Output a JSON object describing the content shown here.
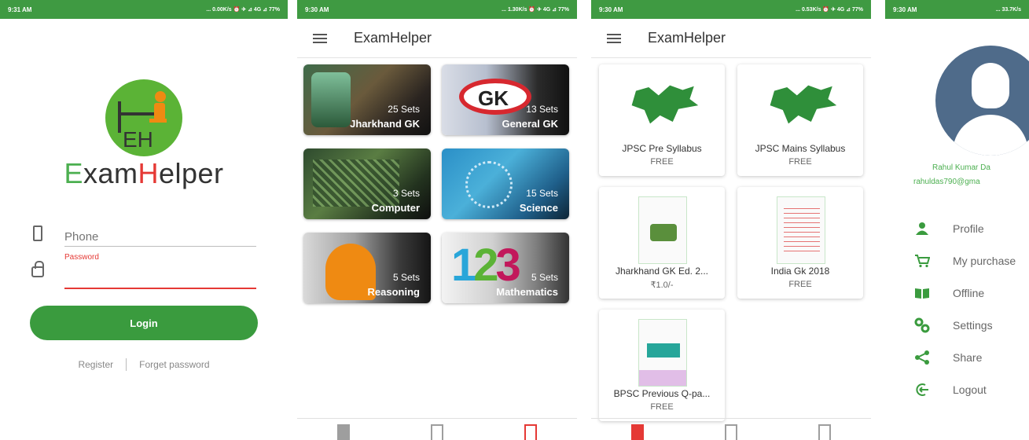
{
  "screen1": {
    "status": {
      "time": "9:31 AM",
      "info": "... 0.00K/s ⏰ ✈ ⊿ 4G ⊿ 77%"
    },
    "brand": {
      "logo_initials": "EH",
      "app_name_1": "E",
      "app_name_2": "xam",
      "app_name_3": "H",
      "app_name_4": "elper"
    },
    "phone_placeholder": "Phone",
    "password_label": "Password",
    "login_label": "Login",
    "register_label": "Register",
    "forget_label": "Forget password",
    "colors": {
      "primary": "#3a9b3e",
      "error": "#e53935"
    }
  },
  "screen2": {
    "status": {
      "time": "9:30 AM",
      "info": "... 1.30K/s ⏰ ✈ 4G ⊿ 77%"
    },
    "title": "ExamHelper",
    "categories": [
      {
        "sets": "25 Sets",
        "name": "Jharkhand GK"
      },
      {
        "sets": "13 Sets",
        "name": "General GK"
      },
      {
        "sets": "3 Sets",
        "name": "Computer"
      },
      {
        "sets": "15 Sets",
        "name": "Science"
      },
      {
        "sets": "5 Sets",
        "name": "Reasoning"
      },
      {
        "sets": "5 Sets",
        "name": "Mathematics"
      }
    ],
    "gk_art_text": "GK",
    "math_art": {
      "one": "1",
      "two": "2",
      "three": "3",
      "divide": "÷",
      "plus": "+"
    }
  },
  "screen3": {
    "status": {
      "time": "9:30 AM",
      "info": "... 0.53K/s ⏰ ✈ 4G ⊿ 77%"
    },
    "title": "ExamHelper",
    "items": [
      {
        "name": "JPSC Pre Syllabus",
        "price": "FREE"
      },
      {
        "name": "JPSC Mains Syllabus",
        "price": "FREE"
      },
      {
        "name": "Jharkhand GK Ed. 2...",
        "price": "₹1.0/-"
      },
      {
        "name": "India Gk 2018",
        "price": "FREE"
      },
      {
        "name": "BPSC Previous Q-pa...",
        "price": "FREE"
      }
    ]
  },
  "screen4": {
    "status": {
      "time": "9:30 AM",
      "info": "... 33.7K/s"
    },
    "user_name": "Rahul Kumar Da",
    "user_email": "rahuldas790@gma",
    "menu": [
      {
        "icon": "person-icon",
        "label": "Profile"
      },
      {
        "icon": "cart-icon",
        "label": "My purchase"
      },
      {
        "icon": "book-icon",
        "label": "Offline"
      },
      {
        "icon": "settings-icon",
        "label": "Settings"
      },
      {
        "icon": "share-icon",
        "label": "Share"
      },
      {
        "icon": "logout-icon",
        "label": "Logout"
      }
    ]
  }
}
